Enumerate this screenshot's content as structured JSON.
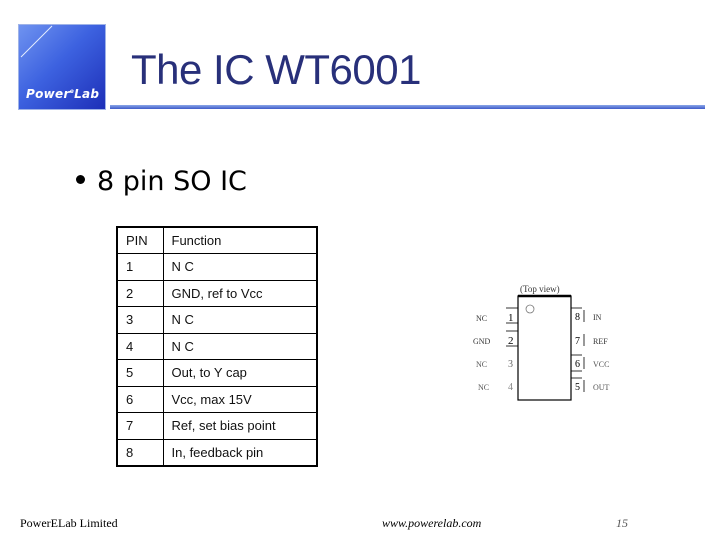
{
  "logo": {
    "text": "Power",
    "sup": "e",
    "text2": "Lab"
  },
  "title": "The IC WT6001",
  "bullet": "8 pin SO IC",
  "table": {
    "headers": [
      "PIN",
      "Function"
    ],
    "rows": [
      [
        "1",
        "N C"
      ],
      [
        "2",
        "GND, ref to Vcc"
      ],
      [
        "3",
        "N C"
      ],
      [
        "4",
        "N C"
      ],
      [
        "5",
        "Out, to Y cap"
      ],
      [
        "6",
        "Vcc, max 15V"
      ],
      [
        "7",
        "Ref, set bias point"
      ],
      [
        "8",
        "In, feedback pin"
      ]
    ]
  },
  "diagram": {
    "caption": "(Top view)",
    "left_pins": [
      {
        "num": "1",
        "label": "NC"
      },
      {
        "num": "2",
        "label": "GND"
      },
      {
        "num": "3",
        "label": "NC"
      },
      {
        "num": "4",
        "label": "NC"
      }
    ],
    "right_pins": [
      {
        "num": "8",
        "label": "IN"
      },
      {
        "num": "7",
        "label": "REF"
      },
      {
        "num": "6",
        "label": "VCC"
      },
      {
        "num": "5",
        "label": "OUT"
      }
    ]
  },
  "footer": {
    "company": "PowerELab Limited",
    "website": "www.powerelab.com",
    "page_number": "15"
  }
}
